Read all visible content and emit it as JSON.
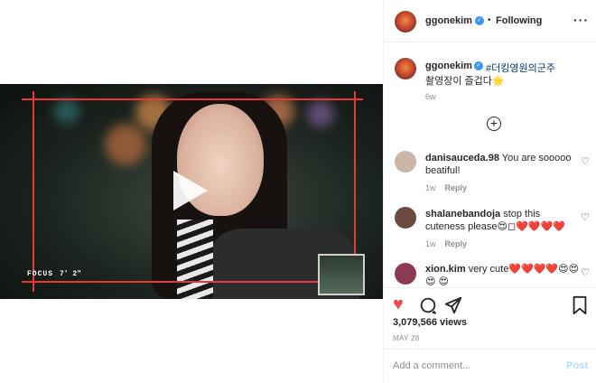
{
  "post": {
    "username": "ggonekim",
    "follow_status": "Following",
    "caption_hashtag": "#더킹영원의군주",
    "caption_text": "촬영장이 즐겁다🌟",
    "caption_age": "6w",
    "views": "3,079,566 views",
    "date": "MAY 28"
  },
  "video": {
    "focus_label": "FOCUS",
    "focus_value": "7'  2\""
  },
  "comments": [
    {
      "username": "danisauceda.98",
      "text": "You are sooooo beatiful!",
      "age": "1w",
      "reply_label": "Reply",
      "avatar_color": "#c9b6a6"
    },
    {
      "username": "shalanebandoja",
      "text": "stop this cuteness please😍◻❤️❤️❤️❤️",
      "age": "1w",
      "reply_label": "Reply",
      "avatar_color": "#6b4a3f"
    },
    {
      "username": "xion.kim",
      "text": "very cute❤️❤️❤️❤️😍😍😍 😍",
      "avatar_color": "#8c3a52"
    }
  ],
  "comment_box": {
    "placeholder": "Add a comment...",
    "post_label": "Post"
  },
  "icons": {
    "verified": "verified-badge-icon",
    "more": "more-options-icon",
    "load_more": "plus-circle-icon",
    "like": "heart-filled-icon",
    "comment": "comment-icon",
    "share": "share-icon",
    "save": "bookmark-icon",
    "play": "play-icon"
  },
  "colors": {
    "like_red": "#ed4956",
    "verified_blue": "#3897f0",
    "post_button": "#b2dffc",
    "frame_red": "#e53935"
  }
}
